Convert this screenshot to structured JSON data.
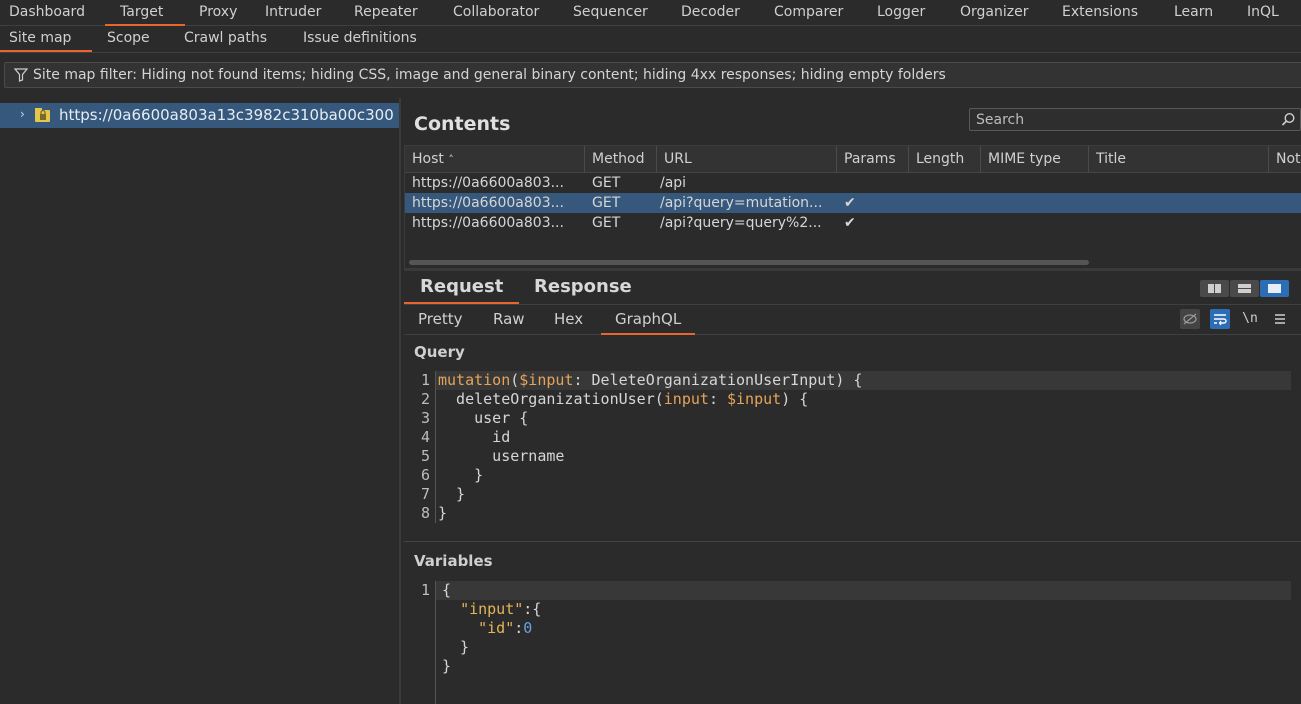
{
  "main_tabs": [
    "Dashboard",
    "Target",
    "Proxy",
    "Intruder",
    "Repeater",
    "Collaborator",
    "Sequencer",
    "Decoder",
    "Comparer",
    "Logger",
    "Organizer",
    "Extensions",
    "Learn",
    "InQL"
  ],
  "main_active": "Target",
  "sub_tabs": [
    "Site map",
    "Scope",
    "Crawl paths",
    "Issue definitions"
  ],
  "sub_active": "Site map",
  "filter_text": "Site map filter: Hiding not found items;  hiding CSS, image and general binary content;  hiding 4xx responses;  hiding empty folders",
  "tree": {
    "host": "https://0a6600a803a13c3982c310ba00c300"
  },
  "contents": {
    "title": "Contents",
    "search_placeholder": "Search",
    "columns": [
      "Host",
      "Method",
      "URL",
      "Params",
      "Length",
      "MIME type",
      "Title",
      "Notes"
    ],
    "rows": [
      {
        "host": "https://0a6600a803...",
        "method": "GET",
        "url": "/api",
        "params": "",
        "selected": false
      },
      {
        "host": "https://0a6600a803...",
        "method": "GET",
        "url": "/api?query=mutation...",
        "params": "✔",
        "selected": true
      },
      {
        "host": "https://0a6600a803...",
        "method": "GET",
        "url": "/api?query=query%2...",
        "params": "✔",
        "selected": false
      }
    ]
  },
  "message_tabs": [
    "Request",
    "Response"
  ],
  "message_active": "Request",
  "view_tabs": [
    "Pretty",
    "Raw",
    "Hex",
    "GraphQL"
  ],
  "view_active": "GraphQL",
  "newline_toggle": "\\n",
  "query_label": "Query",
  "variables_label": "Variables",
  "query_lines": [
    "mutation($input: DeleteOrganizationUserInput) {",
    "  deleteOrganizationUser(input: $input) {",
    "    user {",
    "      id",
    "      username",
    "    }",
    "  }",
    "}"
  ],
  "variables_lines": [
    "{",
    "  \"input\":{",
    "    \"id\":0",
    "  }",
    "}"
  ],
  "colors": {
    "accent": "#e8652f",
    "selection": "#36587c",
    "active_button": "#2d6db5",
    "keyword": "#e5a45a",
    "number": "#6aa0e0"
  }
}
